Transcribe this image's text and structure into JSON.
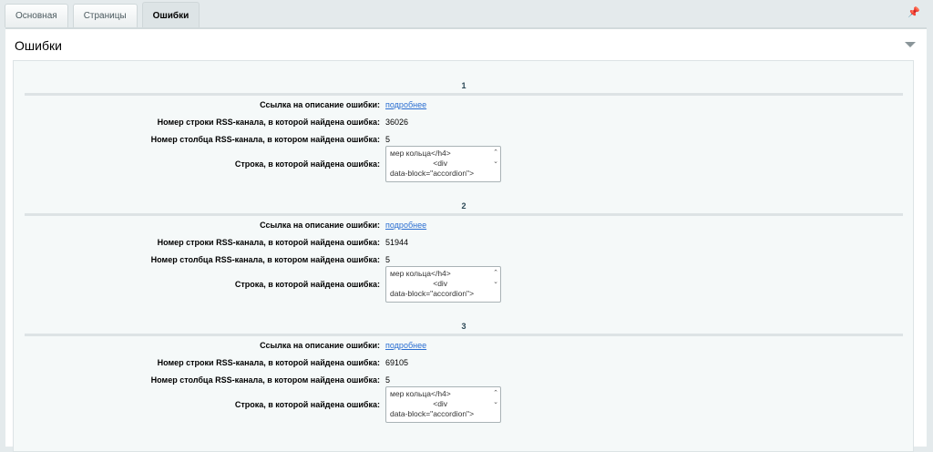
{
  "tabs": [
    {
      "label": "Основная"
    },
    {
      "label": "Страницы"
    },
    {
      "label": "Ошибки",
      "active": true
    }
  ],
  "panel": {
    "title": "Ошибки"
  },
  "labels": {
    "link": "Ссылка на описание ошибки:",
    "line": "Номер строки RSS-канала, в которой найдена ошибка:",
    "column": "Номер столбца RSS-канала, в котором найдена ошибка:",
    "string": "Строка, в которой найдена ошибка:"
  },
  "errors": [
    {
      "number": "1",
      "link": "подробнее",
      "line": "36026",
      "column": "5",
      "text": "мер кольца</h4>\n                    <div\ndata-block=\"accordion\">"
    },
    {
      "number": "2",
      "link": "подробнее",
      "line": "51944",
      "column": "5",
      "text": "мер кольца</h4>\n                    <div\ndata-block=\"accordion\">"
    },
    {
      "number": "3",
      "link": "подробнее",
      "line": "69105",
      "column": "5",
      "text": "мер кольца</h4>\n                    <div\ndata-block=\"accordion\">"
    }
  ]
}
